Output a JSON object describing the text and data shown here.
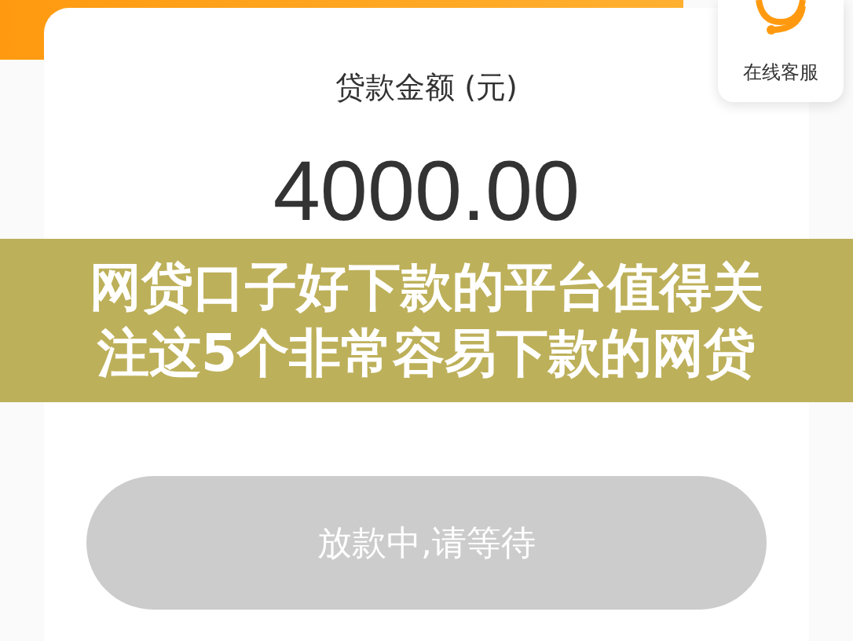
{
  "service": {
    "label": "在线客服"
  },
  "loan": {
    "label": "贷款金额 (元)",
    "amount": "4000.00"
  },
  "button": {
    "label": "放款中,请等待",
    "disabled": true
  },
  "caption": {
    "text": "网贷口子好下款的平台值得关注这5个非常容易下款的网贷"
  }
}
